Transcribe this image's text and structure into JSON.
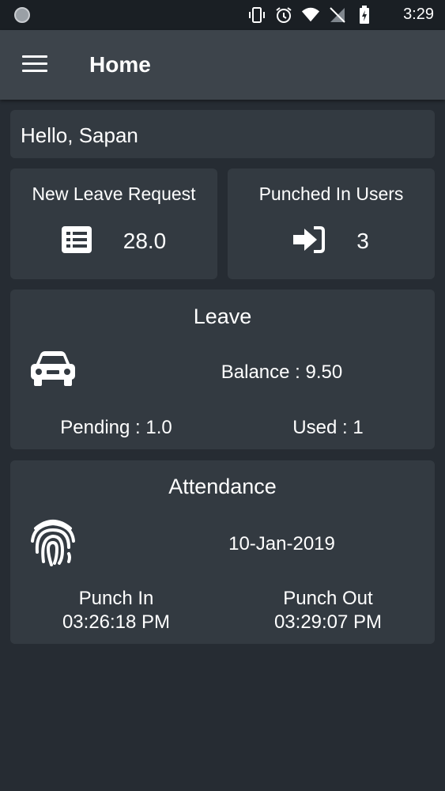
{
  "status_bar": {
    "time": "3:29",
    "icons": [
      "vibrate-icon",
      "alarm-icon",
      "wifi-icon",
      "no-signal-icon",
      "battery-charging-icon"
    ]
  },
  "app_bar": {
    "title": "Home",
    "menu_icon": "hamburger-menu-icon"
  },
  "greeting": "Hello, Sapan",
  "stats": [
    {
      "title": "New Leave Request",
      "value": "28.0",
      "icon": "list-icon"
    },
    {
      "title": "Punched In Users",
      "value": "3",
      "icon": "sign-in-icon"
    }
  ],
  "leave": {
    "title": "Leave",
    "icon": "car-icon",
    "balance": "Balance : 9.50",
    "pending": "Pending : 1.0",
    "used": "Used : 1"
  },
  "attendance": {
    "title": "Attendance",
    "icon": "fingerprint-icon",
    "date": "10-Jan-2019",
    "punch_in_label": "Punch In",
    "punch_in_time": "03:26:18 PM",
    "punch_out_label": "Punch Out",
    "punch_out_time": "03:29:07 PM"
  },
  "colors": {
    "background": "#262c33",
    "app_bar": "#3d444b",
    "card": "#333a41",
    "text": "#ffffff"
  }
}
